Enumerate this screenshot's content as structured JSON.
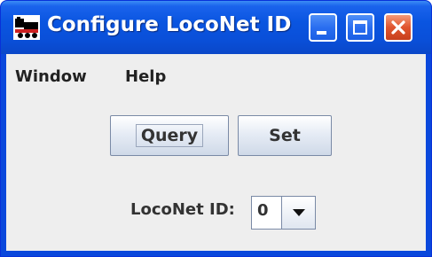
{
  "window": {
    "title": "Configure LocoNet ID",
    "icon": "loconet-app-icon",
    "controls": [
      "minimize-icon",
      "maximize-icon",
      "close-icon"
    ],
    "titlebar_color": "#0a55e0",
    "close_color": "#e0542e"
  },
  "menubar": {
    "items": [
      {
        "label": "Window"
      },
      {
        "label": "Help"
      }
    ]
  },
  "buttons": {
    "query_label": "Query",
    "set_label": "Set"
  },
  "loconet_id": {
    "label": "LocoNet ID:",
    "value": "0"
  }
}
